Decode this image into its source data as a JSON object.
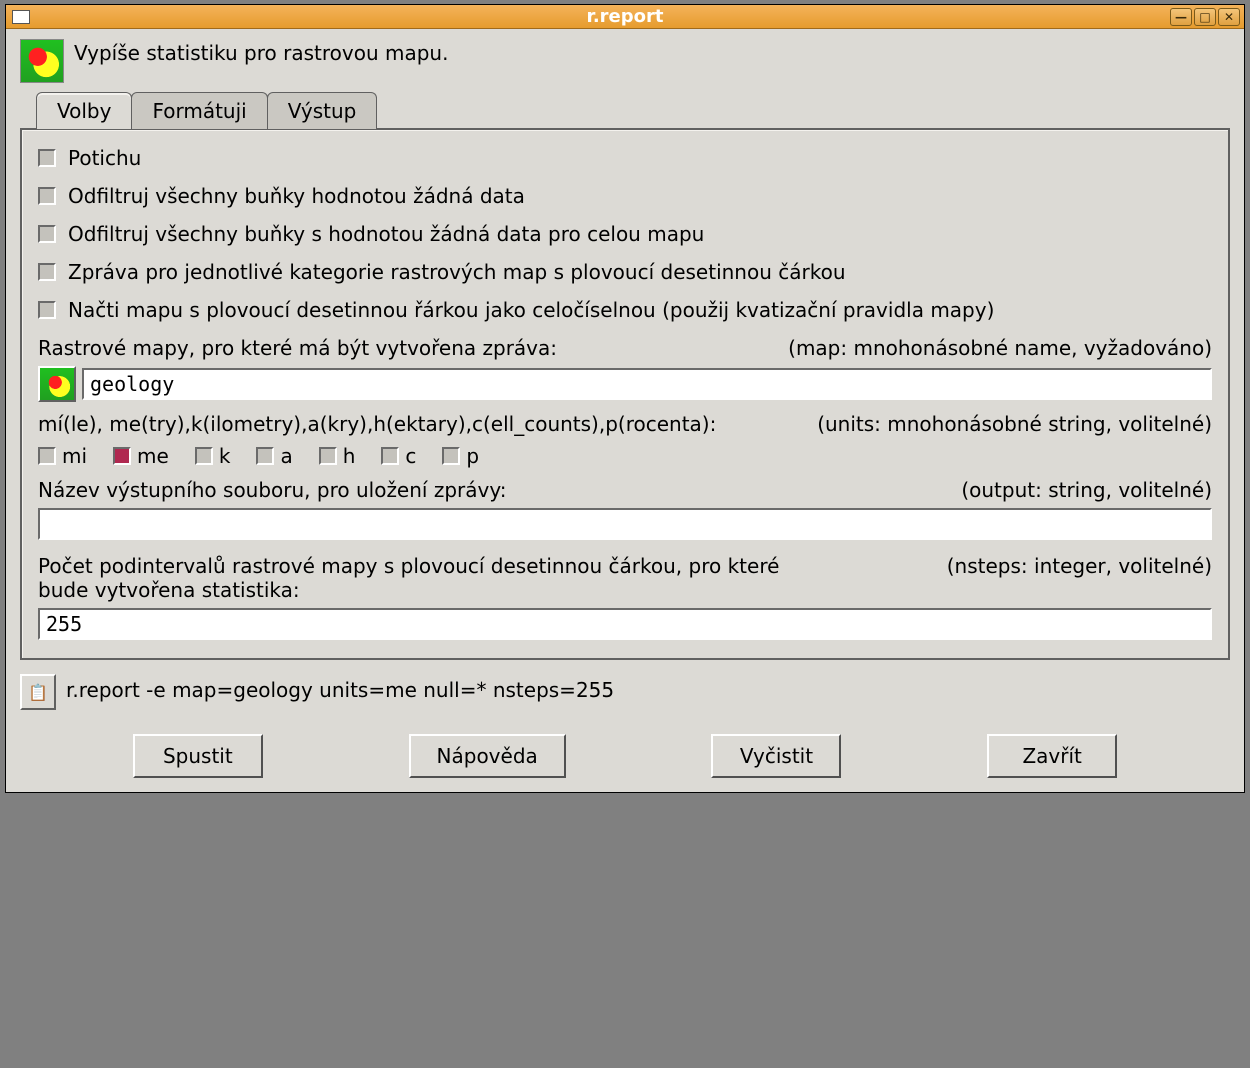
{
  "window": {
    "title": "r.report"
  },
  "header": {
    "description": "Vypíše statistiku pro rastrovou mapu."
  },
  "tabs": {
    "options": "Volby",
    "format": "Formátuji",
    "output": "Výstup"
  },
  "checks": {
    "quiet": "Potichu",
    "filter_nodata": "Odfiltruj všechny buňky hodnotou žádná data",
    "filter_nodata_whole": "Odfiltruj všechny buňky s hodnotou žádná data pro celou mapu",
    "fp_categories": "Zpráva pro jednotlivé kategorie rastrových map s plovoucí desetinnou čárkou",
    "read_fp_as_int": "Načti mapu s plovoucí desetinnou řárkou jako celočíselnou (použij kvatizační pravidla mapy)"
  },
  "map": {
    "label": "Rastrové mapy, pro které má být vytvořena zpráva:",
    "hint": "(map: mnohonásobné name, vyžadováno)",
    "value": "geology"
  },
  "units": {
    "label": "mí(le), me(try),k(ilometry),a(kry),h(ektary),c(ell_counts),p(rocenta):",
    "hint": "(units: mnohonásobné string, volitelné)",
    "mi": "mi",
    "me": "me",
    "k": "k",
    "a": "a",
    "h": "h",
    "c": "c",
    "p": "p"
  },
  "output": {
    "label": "Název výstupního souboru, pro uložení zprávy:",
    "hint": "(output:  string, volitelné)",
    "value": ""
  },
  "nsteps": {
    "label": "Počet podintervalů rastrové mapy s plovoucí desetinnou čárkou, pro které bude vytvořena statistika:",
    "hint": "(nsteps:  integer, volitelné)",
    "value": "255"
  },
  "command": "r.report -e map=geology units=me null=* nsteps=255",
  "buttons": {
    "run": "Spustit",
    "help": "Nápověda",
    "clear": "Vyčistit",
    "close": "Zavřít"
  },
  "icons": {
    "minimize": "—",
    "maximize": "□",
    "close_x": "✕",
    "copy": "📋"
  }
}
